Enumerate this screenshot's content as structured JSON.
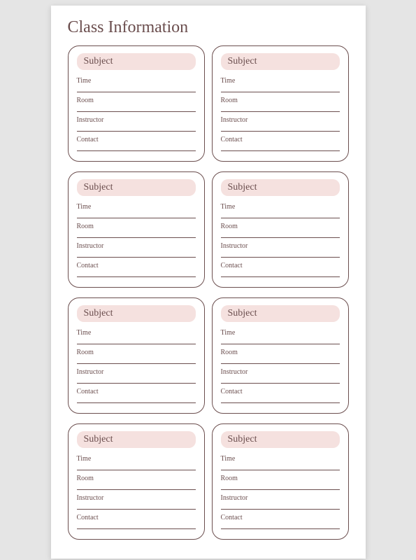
{
  "title": "Class Information",
  "card": {
    "subject_label": "Subject",
    "fields": [
      "Time",
      "Room",
      "Instructor",
      "Contact"
    ]
  },
  "card_count": 8
}
